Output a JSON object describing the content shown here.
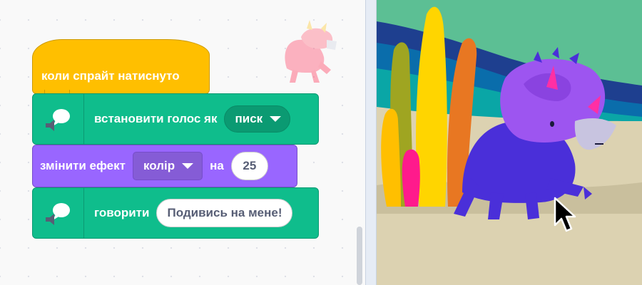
{
  "code_area": {
    "hat_block": {
      "label": "коли спрайт натиснуто"
    },
    "block_set_voice": {
      "label": "встановити голос як",
      "voice_value": "писк"
    },
    "block_change_effect": {
      "label": "змінити ефект",
      "effect_value": "колір",
      "by_label": "на",
      "amount": "25"
    },
    "block_say": {
      "label": "говорити",
      "text": "Подивись на мене!"
    }
  },
  "stage": {
    "sprite_name_icon": "triceratops-sprite",
    "cursor_icon": "mouse-pointer-icon"
  },
  "colors": {
    "events": "#ffbf00",
    "extension": "#0fbd8c",
    "looks": "#9966ff",
    "stage_sky": "#5cbf94",
    "stage_ground": "#dcd2b1"
  }
}
